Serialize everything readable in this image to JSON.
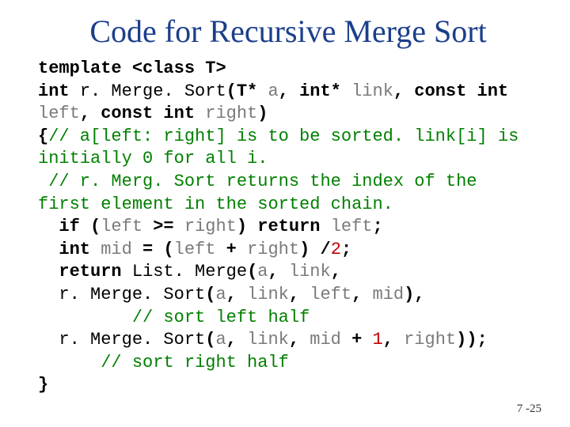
{
  "title": "Code for Recursive Merge Sort",
  "code": {
    "l1a": "template ",
    "l1b": "<class T>",
    "l2a": "int ",
    "l2b": "r. Merge. Sort",
    "l2c": "(T* ",
    "l2d": "a",
    "l2e": ", int* ",
    "l2f": "link",
    "l2g": ", const int ",
    "l2h": "left",
    "l2i": ", const int ",
    "l2j": "right",
    "l2k": ")",
    "l3a": "{",
    "l3b": "// a[left: right] is to be sorted. link[i] is initially 0 for all i.",
    "l4": " // r. Merg. Sort returns the index of the first element in the sorted chain.",
    "l5a": "  if (",
    "l5b": "left",
    "l5c": " >= ",
    "l5d": "right",
    "l5e": ") return ",
    "l5f": "left",
    "l5g": ";",
    "l6a": "  int ",
    "l6b": "mid",
    "l6c": " = (",
    "l6d": "left",
    "l6e": " + ",
    "l6f": "right",
    "l6g": ") /",
    "l6h": "2",
    "l6i": ";",
    "l7a": "  return ",
    "l7b": "List. Merge",
    "l7c": "(",
    "l7d": "a",
    "l7e": ", ",
    "l7f": "link",
    "l7g": ",",
    "l8a": "  ",
    "l8b": "r. Merge. Sort",
    "l8c": "(",
    "l8d": "a",
    "l8e": ", ",
    "l8f": "link",
    "l8g": ", ",
    "l8h": "left",
    "l8i": ", ",
    "l8j": "mid",
    "l8k": "),",
    "l9": "         // sort left half",
    "l10a": "  ",
    "l10b": "r. Merge. Sort",
    "l10c": "(",
    "l10d": "a",
    "l10e": ", ",
    "l10f": "link",
    "l10g": ", ",
    "l10h": "mid",
    "l10i": " + ",
    "l10j": "1",
    "l10k": ", ",
    "l10l": "right",
    "l10m": "));",
    "l11": "      // sort right half",
    "l12": "}"
  },
  "pagenum": "7 -25"
}
